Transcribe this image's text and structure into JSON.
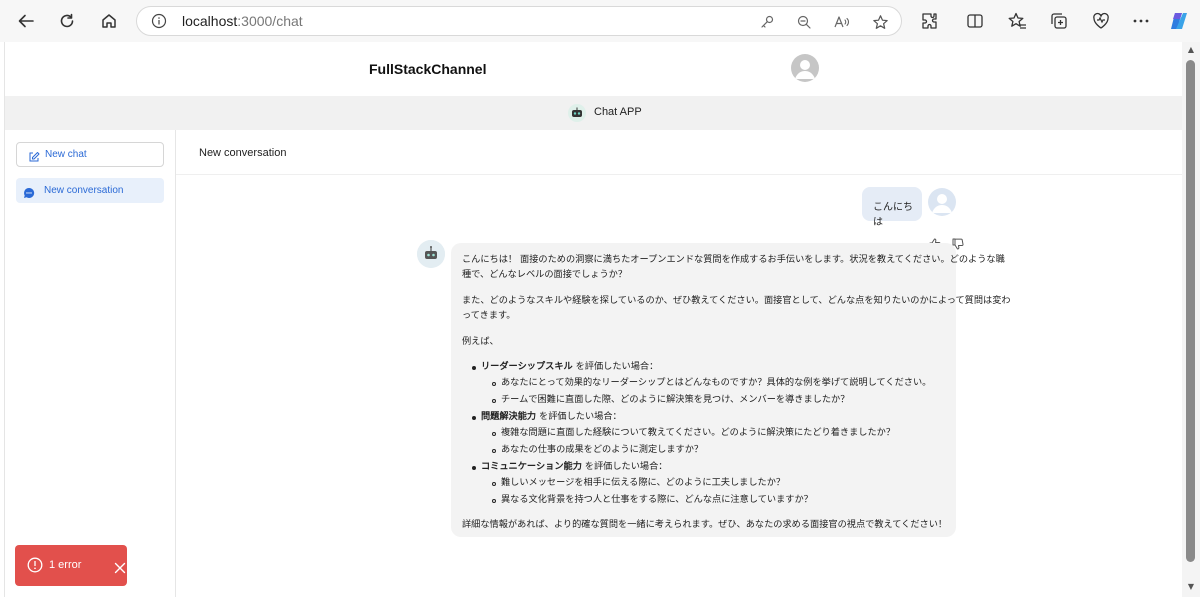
{
  "browser": {
    "url_host": "localhost",
    "url_path": ":3000/chat"
  },
  "header": {
    "app_title": "FullStackChannel"
  },
  "subbar": {
    "label": "Chat APP"
  },
  "sidebar": {
    "new_chat_label": "New chat",
    "items": [
      {
        "label": "New conversation"
      }
    ]
  },
  "main": {
    "conversation_title": "New conversation",
    "user_message": "こんにちは",
    "bot_message": {
      "p1_line1": "こんにちは！ 面接のための洞察に満ちたオープンエンドな質問を作成するお手伝いをします。状況を教えてください。どのような職",
      "p1_line2": "種で、どんなレベルの面接でしょうか？",
      "p2_line1": "また、どのようなスキルや経験を探しているのか、ぜひ教えてください。面接官として、どんな点を知りたいのかによって質問は変わ",
      "p2_line2": "ってきます。",
      "p3": "例えば、",
      "sections": [
        {
          "title": "リーダーシップスキル",
          "suffix": " を評価したい場合：",
          "items": [
            "あなたにとって効果的なリーダーシップとはどんなものですか？具体的な例を挙げて説明してください。",
            "チームで困難に直面した際、どのように解決策を見つけ、メンバーを導きましたか？"
          ]
        },
        {
          "title": "問題解決能力",
          "suffix": " を評価したい場合：",
          "items": [
            "複雑な問題に直面した経験について教えてください。どのように解決策にたどり着きましたか？",
            "あなたの仕事の成果をどのように測定しますか？"
          ]
        },
        {
          "title": "コミュニケーション能力",
          "suffix": " を評価したい場合：",
          "items": [
            "難しいメッセージを相手に伝える際に、どのように工夫しましたか？",
            "異なる文化背景を持つ人と仕事をする際に、どんな点に注意していますか？"
          ]
        }
      ],
      "closing": "詳細な情報があれば、より的確な質問を一緒に考えられます。ぜひ、あなたの求める面接官の視点で教えてください！"
    }
  },
  "toast": {
    "label": "1 error"
  },
  "colors": {
    "accent": "#2b6ad6",
    "error": "#e2504c",
    "user_bubble": "#e5ecf6",
    "bot_bubble": "#f3f3f3"
  }
}
